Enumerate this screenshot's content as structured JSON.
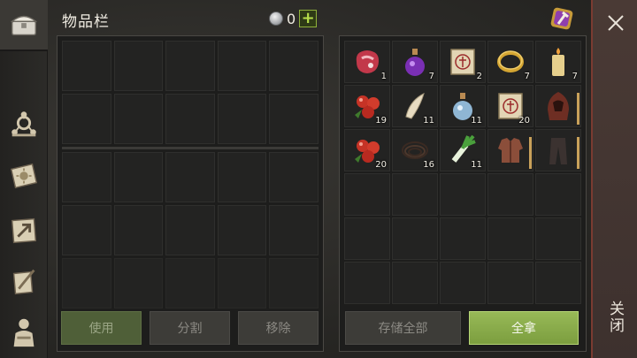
{
  "header": {
    "title": "物品栏",
    "currency_amount": "0",
    "add_symbol": "+"
  },
  "rail": {
    "items": [
      {
        "icon": "chest-icon",
        "active": true
      },
      {
        "icon": "skill-network-icon",
        "active": false
      },
      {
        "icon": "sun-book-icon",
        "active": false
      },
      {
        "icon": "map-arrow-icon",
        "active": false
      },
      {
        "icon": "scroll-quill-icon",
        "active": false
      },
      {
        "icon": "character-icon",
        "active": false
      }
    ]
  },
  "storage": {
    "items": [
      {
        "name": "raw-meat-icon",
        "qty": "1"
      },
      {
        "name": "purple-potion-icon",
        "qty": "7"
      },
      {
        "name": "recipe-scroll-icon",
        "qty": "2"
      },
      {
        "name": "gold-ring-icon",
        "qty": "7"
      },
      {
        "name": "candle-icon",
        "qty": "7"
      },
      {
        "name": "red-berries-icon",
        "qty": "19"
      },
      {
        "name": "horn-icon",
        "qty": "11"
      },
      {
        "name": "blue-potion-icon",
        "qty": "11"
      },
      {
        "name": "recipe-scroll-icon",
        "qty": "20"
      },
      {
        "name": "hood-icon",
        "qty": ""
      },
      {
        "name": "red-berries-icon",
        "qty": "20"
      },
      {
        "name": "rope-icon",
        "qty": "16"
      },
      {
        "name": "leek-icon",
        "qty": "11"
      },
      {
        "name": "leather-jacket-icon",
        "qty": ""
      },
      {
        "name": "leather-pants-icon",
        "qty": ""
      }
    ]
  },
  "buttons": {
    "use": "使用",
    "split": "分割",
    "remove": "移除",
    "store_all": "存储全部",
    "take_all": "全拿"
  },
  "close": {
    "label": "关闭"
  },
  "colors": {
    "accent_green": "#8fb13a",
    "close_border": "#7a3b31"
  }
}
